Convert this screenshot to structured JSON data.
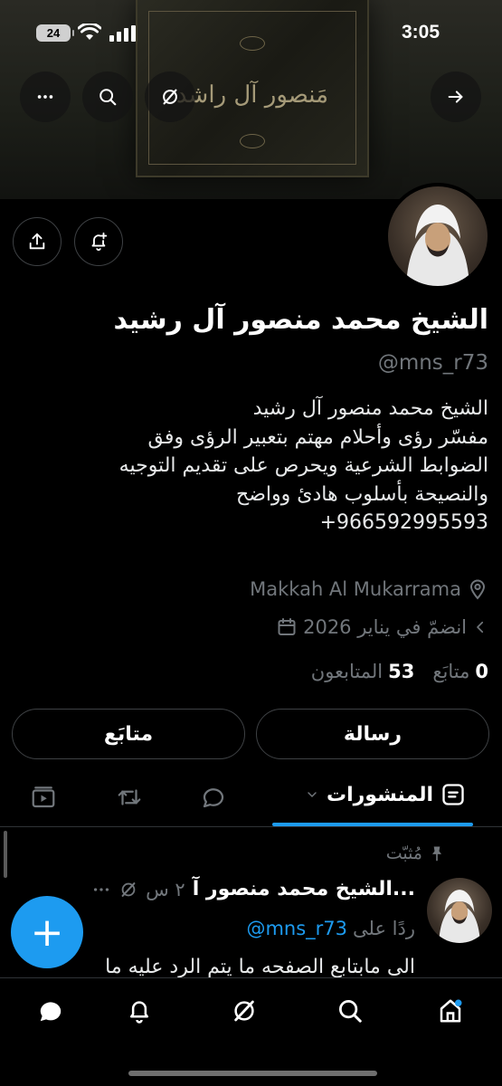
{
  "status_bar": {
    "time": "3:05",
    "battery": "24"
  },
  "banner": {
    "book_title": "مَنصور آل راشد"
  },
  "profile": {
    "name": "الشيخ محمد منصور آل رشيد",
    "handle": "@mns_r73",
    "bio_lines": [
      "الشيخ محمد منصور آل رشيد",
      "مفسّر رؤى وأحلام مهتم بتعبير الرؤى وفق",
      "الضوابط الشرعية ويحرص على تقديم التوجيه",
      "والنصيحة بأسلوب هادئ وواضح",
      "+966592995593"
    ],
    "location": "Makkah Al Mukarrama",
    "joined": "انضمّ في يناير 2026",
    "following_count": "0",
    "following_label": "متابَع",
    "followers_count": "53",
    "followers_label": "المتابعون"
  },
  "actions": {
    "message_label": "رسالة",
    "follow_label": "متابَع"
  },
  "tabs": {
    "posts_label": "المنشورات"
  },
  "tweet": {
    "pinned_label": "مُثبّت",
    "author": "الشيخ محمد منصور آ...",
    "time": "٢ س",
    "reply_prefix": "ردًا على",
    "reply_handle": "@mns_r73",
    "text": "الى مابتابع الصفحه ما يتم الرد عليه ما"
  },
  "fab": {
    "label": "+"
  },
  "colors": {
    "accent": "#1d9bf0",
    "muted": "#71767b",
    "background": "#000000"
  }
}
